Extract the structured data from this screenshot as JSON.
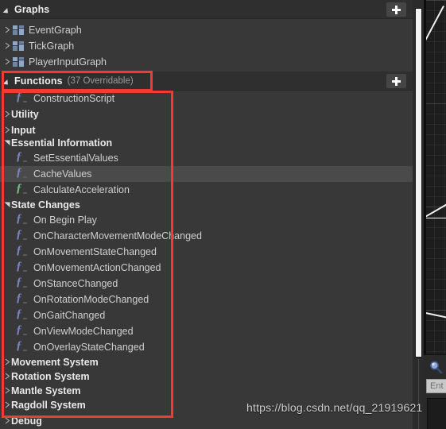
{
  "panel": {
    "sections": [
      {
        "id": "graphs",
        "title": "Graphs",
        "subtitle": "",
        "add_label": "+",
        "expanded": true
      },
      {
        "id": "functions",
        "title": "Functions",
        "subtitle": "(37 Overridable)",
        "add_label": "+",
        "expanded": true
      }
    ],
    "graphs_items": [
      {
        "label": "EventGraph",
        "icon": "graph-icon",
        "expander": "collapsed"
      },
      {
        "label": "TickGraph",
        "icon": "graph-icon",
        "expander": "collapsed"
      },
      {
        "label": "PlayerInputGraph",
        "icon": "graph-icon",
        "expander": "collapsed"
      }
    ],
    "functions_items": [
      {
        "label": "ConstructionScript",
        "kind": "function",
        "icon_color": "blue",
        "expander": "none",
        "indent": 1,
        "hover": false
      },
      {
        "label": "Utility",
        "kind": "category",
        "icon_color": "",
        "expander": "collapsed",
        "indent": 0,
        "hover": false
      },
      {
        "label": "Input",
        "kind": "category",
        "icon_color": "",
        "expander": "collapsed",
        "indent": 0,
        "hover": false
      },
      {
        "label": "Essential Information",
        "kind": "category",
        "icon_color": "",
        "expander": "expanded",
        "indent": 0,
        "hover": false
      },
      {
        "label": "SetEssentialValues",
        "kind": "function",
        "icon_color": "blue",
        "expander": "none",
        "indent": 1,
        "hover": false
      },
      {
        "label": "CacheValues",
        "kind": "function",
        "icon_color": "blue",
        "expander": "none",
        "indent": 1,
        "hover": true
      },
      {
        "label": "CalculateAcceleration",
        "kind": "function",
        "icon_color": "green",
        "expander": "none",
        "indent": 1,
        "hover": false
      },
      {
        "label": "State Changes",
        "kind": "category",
        "icon_color": "",
        "expander": "expanded",
        "indent": 0,
        "hover": false
      },
      {
        "label": "On Begin Play",
        "kind": "function",
        "icon_color": "blue",
        "expander": "none",
        "indent": 1,
        "hover": false
      },
      {
        "label": "OnCharacterMovementModeChanged",
        "kind": "function",
        "icon_color": "blue",
        "expander": "none",
        "indent": 1,
        "hover": false
      },
      {
        "label": "OnMovementStateChanged",
        "kind": "function",
        "icon_color": "blue",
        "expander": "none",
        "indent": 1,
        "hover": false
      },
      {
        "label": "OnMovementActionChanged",
        "kind": "function",
        "icon_color": "blue",
        "expander": "none",
        "indent": 1,
        "hover": false
      },
      {
        "label": "OnStanceChanged",
        "kind": "function",
        "icon_color": "blue",
        "expander": "none",
        "indent": 1,
        "hover": false
      },
      {
        "label": "OnRotationModeChanged",
        "kind": "function",
        "icon_color": "blue",
        "expander": "none",
        "indent": 1,
        "hover": false
      },
      {
        "label": "OnGaitChanged",
        "kind": "function",
        "icon_color": "blue",
        "expander": "none",
        "indent": 1,
        "hover": false
      },
      {
        "label": "OnViewModeChanged",
        "kind": "function",
        "icon_color": "blue",
        "expander": "none",
        "indent": 1,
        "hover": false
      },
      {
        "label": "OnOverlayStateChanged",
        "kind": "function",
        "icon_color": "blue",
        "expander": "none",
        "indent": 1,
        "hover": false
      },
      {
        "label": "Movement System",
        "kind": "category",
        "icon_color": "",
        "expander": "collapsed",
        "indent": 0,
        "hover": false
      },
      {
        "label": "Rotation System",
        "kind": "category",
        "icon_color": "",
        "expander": "collapsed",
        "indent": 0,
        "hover": false
      },
      {
        "label": "Mantle System",
        "kind": "category",
        "icon_color": "",
        "expander": "collapsed",
        "indent": 0,
        "hover": false
      },
      {
        "label": "Ragdoll System",
        "kind": "category",
        "icon_color": "",
        "expander": "collapsed",
        "indent": 0,
        "hover": false
      },
      {
        "label": "Debug",
        "kind": "category",
        "icon_color": "",
        "expander": "collapsed",
        "indent": 0,
        "hover": false
      }
    ]
  },
  "scrollbar": {
    "orientation": "vertical",
    "thumb_position": "top"
  },
  "editor": {
    "search_icon": "search-icon",
    "search_placeholder": "Ent",
    "search_value": ""
  },
  "annotations": [
    {
      "id": "functions-header-box",
      "target": "Functions header"
    },
    {
      "id": "functions-list-box",
      "target": "Functions category list"
    }
  ],
  "watermark": {
    "text": "https://blog.csdn.net/qq_21919621"
  },
  "colors": {
    "panel_bg": "#383838",
    "header_bg": "#2f2f2f",
    "row_hover": "#4a4a4a",
    "text_primary": "#e8e8e8",
    "text_secondary": "#9a9a9a",
    "function_icon_blue": "#7b82c8",
    "function_icon_green": "#6fbf7f",
    "annotation_red": "#f23b33",
    "graph_icon_blue": "#8fa8c8"
  }
}
